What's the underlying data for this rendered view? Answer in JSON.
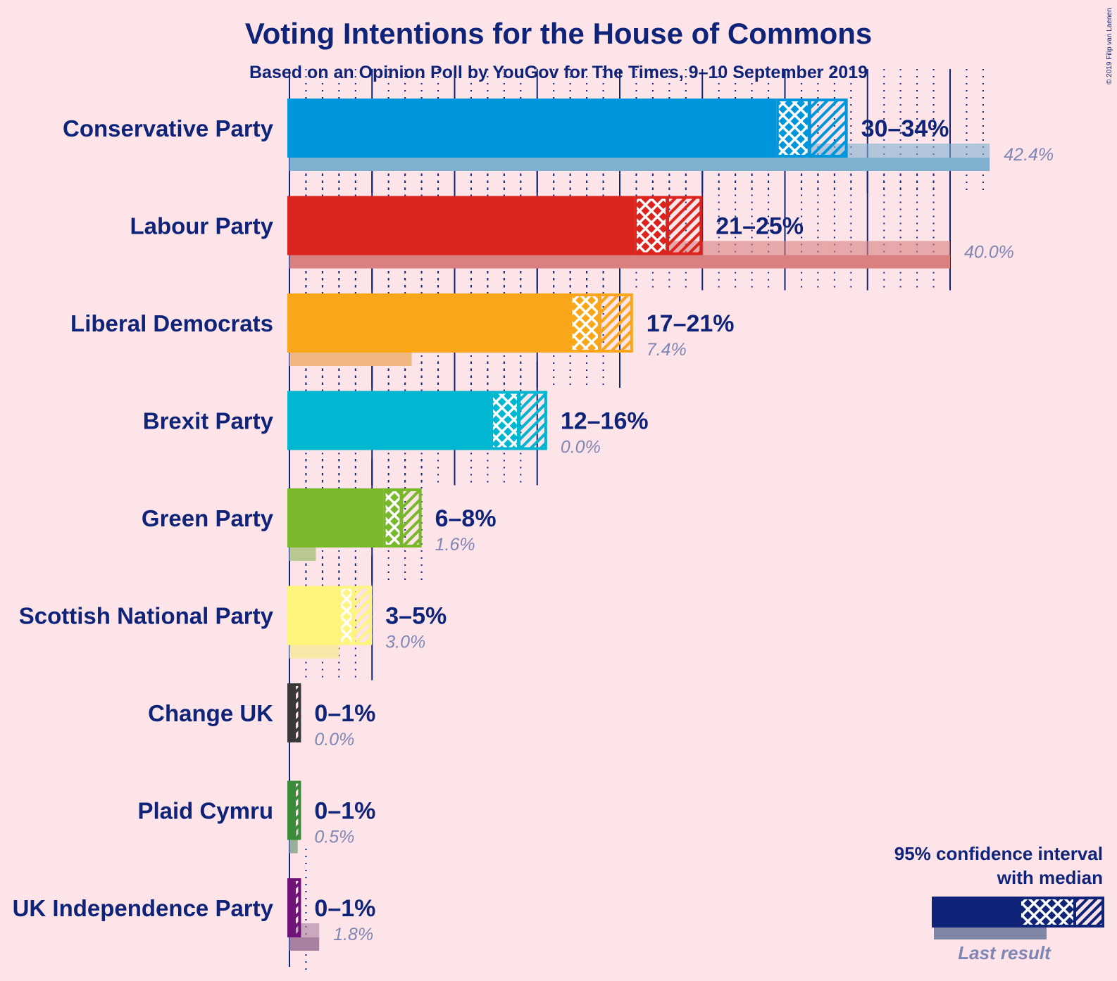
{
  "chart_data": {
    "type": "bar",
    "title": "Voting Intentions for the House of Commons",
    "subtitle": "Based on an Opinion Poll by YouGov for The Times, 9–10 September 2019",
    "copyright": "© 2019 Filip van Laenen",
    "xlabel": "",
    "ylabel": "",
    "xlim": [
      0,
      45
    ],
    "grid": {
      "major_step": 5,
      "minor_step": 1
    },
    "categories": [
      "Conservative Party",
      "Labour Party",
      "Liberal Democrats",
      "Brexit Party",
      "Green Party",
      "Scottish National Party",
      "Change UK",
      "Plaid Cymru",
      "UK Independence Party"
    ],
    "series": [
      {
        "name": "95% confidence interval low",
        "values": [
          29.5,
          20.9,
          17.0,
          12.2,
          5.7,
          3.0,
          0.0,
          0.0,
          0.0
        ]
      },
      {
        "name": "Median",
        "values": [
          31.5,
          22.9,
          18.8,
          13.9,
          6.8,
          3.9,
          0.3,
          0.3,
          0.3
        ]
      },
      {
        "name": "95% confidence interval high",
        "values": [
          33.8,
          25.0,
          20.8,
          15.6,
          8.0,
          5.0,
          0.7,
          0.7,
          0.7
        ]
      },
      {
        "name": "Last result",
        "values": [
          42.4,
          40.0,
          7.4,
          0.0,
          1.6,
          3.0,
          0.0,
          0.5,
          1.8
        ]
      }
    ],
    "range_labels": [
      "30–34%",
      "21–25%",
      "17–21%",
      "12–16%",
      "6–8%",
      "3–5%",
      "0–1%",
      "0–1%",
      "0–1%"
    ],
    "last_labels": [
      "42.4%",
      "40.0%",
      "7.4%",
      "0.0%",
      "1.6%",
      "3.0%",
      "0.0%",
      "0.5%",
      "1.8%"
    ],
    "colors": [
      "#0096db",
      "#dc241f",
      "#faa61a",
      "#00b6d0",
      "#78b82a",
      "#fff57c",
      "#383838",
      "#3a8c3a",
      "#70147a"
    ],
    "last_colors": [
      "#80b0d0",
      "#d98080",
      "#f0b880",
      "#80c8d8",
      "#b8c890",
      "#f8e8a8",
      "#909090",
      "#98b098",
      "#a880a0"
    ],
    "legend": {
      "title_line1": "95% confidence interval",
      "title_line2": "with median",
      "last_result": "Last result",
      "placement": "bottom-right",
      "color": "#0f2378",
      "last_color": "#8086b4"
    }
  }
}
